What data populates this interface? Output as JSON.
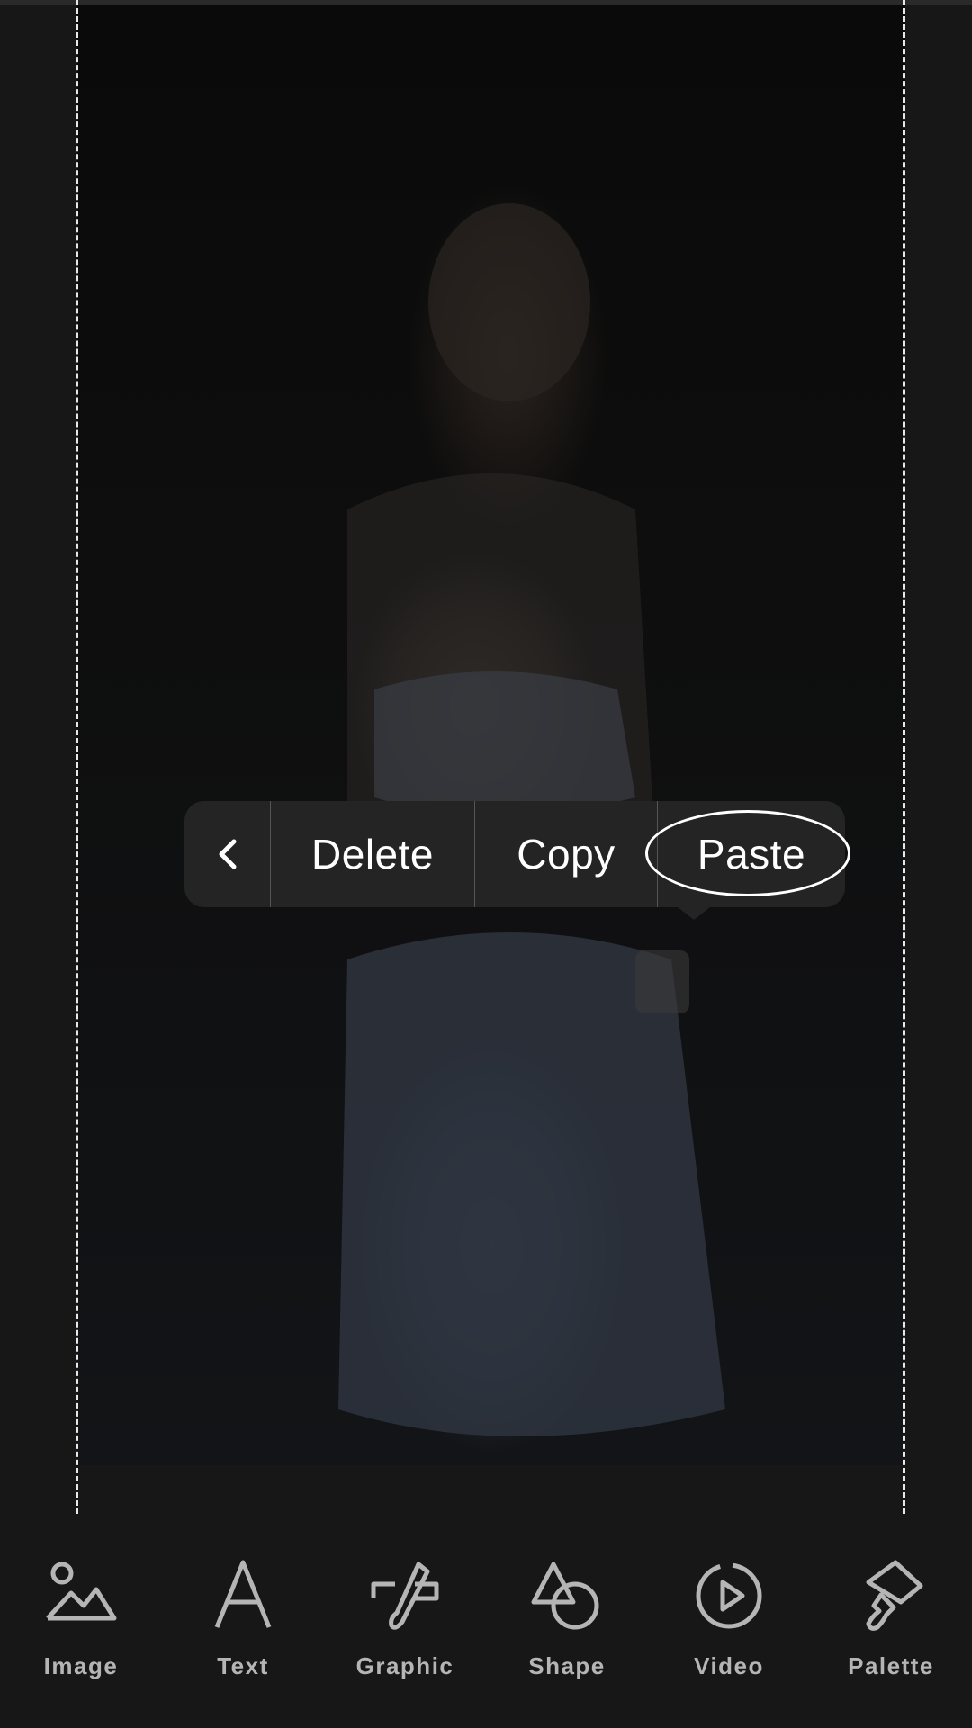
{
  "context_menu": {
    "back_icon": "chevron-left-icon",
    "items": [
      {
        "label": "Delete"
      },
      {
        "label": "Copy"
      },
      {
        "label": "Paste"
      }
    ]
  },
  "toolbar": {
    "items": [
      {
        "label": "Image",
        "icon": "image-icon"
      },
      {
        "label": "Text",
        "icon": "text-icon"
      },
      {
        "label": "Graphic",
        "icon": "graphic-icon"
      },
      {
        "label": "Shape",
        "icon": "shape-icon"
      },
      {
        "label": "Video",
        "icon": "video-icon"
      },
      {
        "label": "Palette",
        "icon": "palette-icon"
      }
    ]
  },
  "colors": {
    "background": "#171717",
    "menu_background": "#242424",
    "toolbar_text": "#b5b5b5",
    "menu_text": "#ffffff"
  }
}
